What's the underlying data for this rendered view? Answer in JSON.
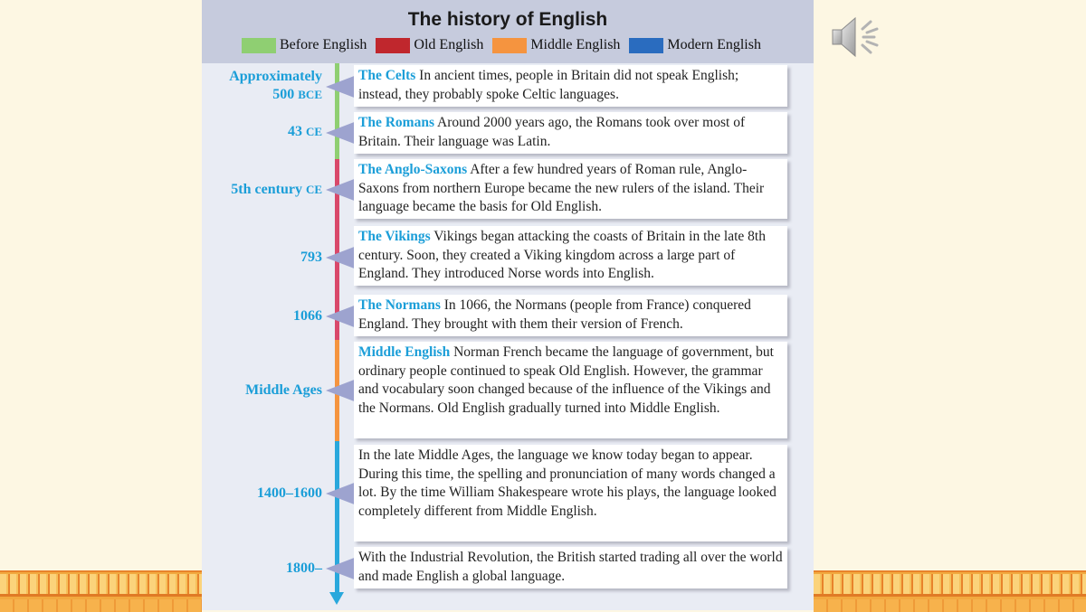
{
  "title": "The history of English",
  "legend": [
    {
      "label": "Before English",
      "color": "#8fcf72"
    },
    {
      "label": "Old English",
      "color": "#c0272d"
    },
    {
      "label": "Middle English",
      "color": "#f5943f"
    },
    {
      "label": "Modern English",
      "color": "#2a6cbf"
    }
  ],
  "timeline": {
    "segment_colors": {
      "before": "#8fcf72",
      "old": "#d9486a",
      "middle": "#f5943f",
      "modern": "#29a8dc"
    }
  },
  "entries": [
    {
      "date_main": "Approximately",
      "date_line2": "500",
      "date_suffix": "BCE",
      "heading": "The Celts",
      "text": "In ancient times, people in Britain did not speak English; instead, they probably spoke Celtic languages."
    },
    {
      "date_main": "43",
      "date_suffix": "CE",
      "heading": "The Romans",
      "text": "Around 2000 years ago, the Romans took over most of Britain. Their language was Latin."
    },
    {
      "date_main": "5th century",
      "date_suffix": "CE",
      "heading": "The Anglo-Saxons",
      "text": "After a few hundred years of Roman rule, Anglo-Saxons from northern Europe became the new rulers of the island. Their language became the basis for Old English."
    },
    {
      "date_main": "793",
      "heading": "The Vikings",
      "text": "Vikings began attacking the coasts of Britain in the late 8th century. Soon, they created a Viking kingdom across a large part of England. They introduced Norse words into English."
    },
    {
      "date_main": "1066",
      "heading": "The Normans",
      "text": "In 1066, the Normans (people from France) conquered England. They brought with them their version of French."
    },
    {
      "date_main": "Middle Ages",
      "heading": "Middle English",
      "text": "Norman French became the language of government, but ordinary people continued to speak Old English. However, the grammar and vocabulary soon changed because of the influence of the Vikings and the Normans. Old English gradually turned into Middle English."
    },
    {
      "date_main": "1400–1600",
      "heading": "",
      "text": "In the late Middle Ages, the language we know today began to appear. During this time, the spelling and pronunciation of many words changed a lot. By the time William Shakespeare wrote his plays, the language looked completely different from Middle English."
    },
    {
      "date_main": "1800–",
      "heading": "",
      "text": "With the Industrial Revolution, the British started trading all over the world and made English a global language."
    }
  ],
  "speaker_icon": "speaker-volume-icon"
}
